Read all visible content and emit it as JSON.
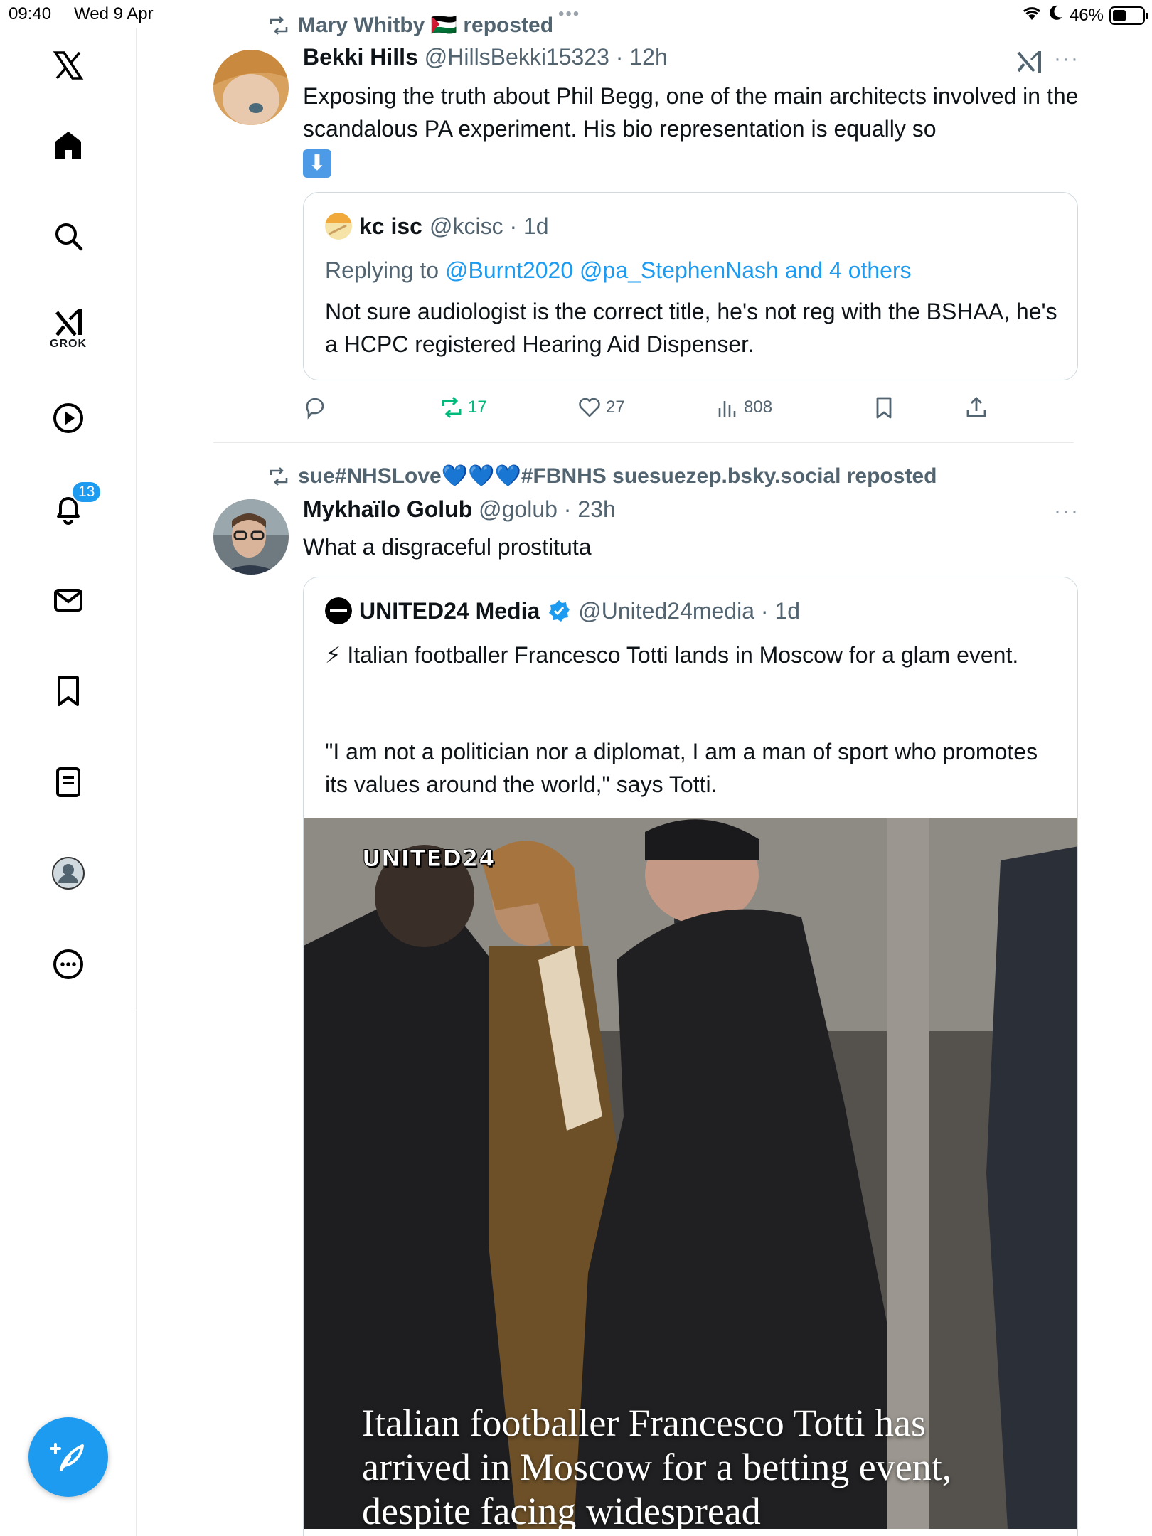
{
  "status_bar": {
    "time": "09:40",
    "date": "Wed 9 Apr",
    "battery": "46%",
    "battery_level": 0.46
  },
  "top_dots": "•••",
  "sidebar": {
    "items": [
      {
        "name": "x-logo",
        "icon": "x-logo-icon"
      },
      {
        "name": "home",
        "icon": "home-icon"
      },
      {
        "name": "explore",
        "icon": "search-icon"
      },
      {
        "name": "grok",
        "icon": "grok-icon",
        "label": "GROK"
      },
      {
        "name": "video",
        "icon": "play-icon"
      },
      {
        "name": "notifications",
        "icon": "bell-icon",
        "badge": "13"
      },
      {
        "name": "messages",
        "icon": "mail-icon"
      },
      {
        "name": "bookmarks",
        "icon": "bookmark-icon"
      },
      {
        "name": "lists",
        "icon": "list-icon"
      },
      {
        "name": "profile",
        "icon": "profile-icon"
      },
      {
        "name": "more",
        "icon": "more-icon"
      }
    ],
    "compose_icon": "compose-icon"
  },
  "tweets": [
    {
      "repost_by": "Mary Whitby 🇵🇸 reposted",
      "name": "Bekki Hills",
      "meta": "@HillsBekki15323 · 12h",
      "more": "···",
      "text": "Exposing the truth about Phil Begg, one of the main architects involved in the scandalous PA experiment. His bio representation is equally so",
      "emoji": "⬇",
      "quote": {
        "name": "kc isc",
        "meta": "@kcisc · 1d",
        "replying_prefix": "Replying to ",
        "replying_to": "@Burnt2020 @pa_StephenNash and 4 others",
        "text": "Not sure audiologist is the correct title, he's not reg with the BSHAA, he's a HCPC registered Hearing Aid Dispenser."
      },
      "actions": {
        "replies": "",
        "reposts": "17",
        "likes": "27",
        "views": "808"
      },
      "accent": "#00ba7c"
    },
    {
      "repost_by": "sue#NHSLove💙💙💙#FBNHS suesuezep.bsky.social reposted",
      "name": "Mykhaïlo Golub",
      "meta": "@golub · 23h",
      "more": "···",
      "text": "What a disgraceful prostituta",
      "quote": {
        "name": "UNITED24 Media",
        "meta": "@United24media · 1d",
        "text_line1": "⚡ Italian footballer Francesco Totti lands in Moscow for a glam event.",
        "text_line2": "\"I am not a politician nor a diplomat, I am a man of sport who promotes its values around the world,\" says Totti.",
        "video_logo": "UNITED24",
        "video_caption": "Italian footballer Francesco Totti has arrived in Moscow for a betting event, despite facing widespread"
      }
    }
  ],
  "colors": {
    "brand_blue": "#1d9bf0",
    "repost_green": "#00ba7c",
    "secondary_text": "#536471"
  }
}
